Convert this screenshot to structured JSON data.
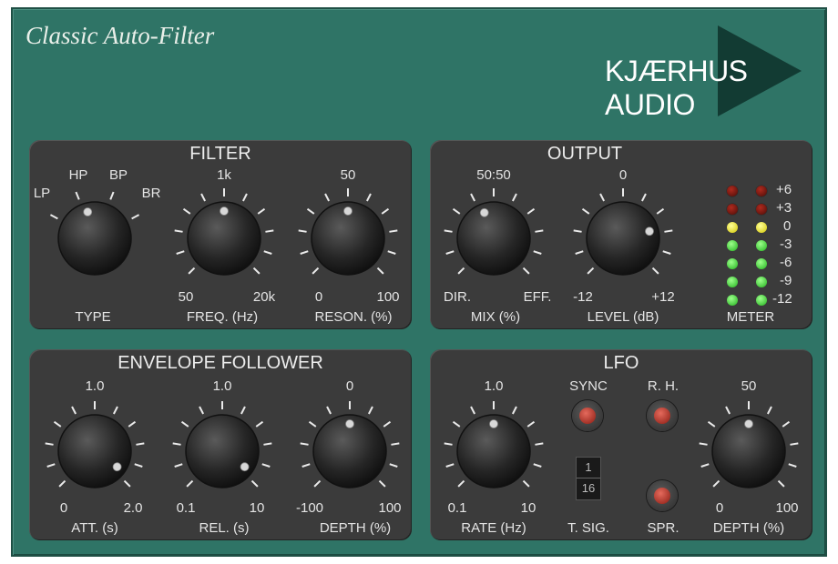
{
  "header": {
    "title": "Classic Auto-Filter",
    "brand": "KJÆRHUS AUDIO"
  },
  "filter": {
    "title": "FILTER",
    "type": {
      "label": "TYPE",
      "options": [
        "LP",
        "HP",
        "BP",
        "BR"
      ]
    },
    "freq": {
      "label": "FREQ. (Hz)",
      "top": "1k",
      "min": "50",
      "max": "20k"
    },
    "reson": {
      "label": "RESON. (%)",
      "top": "50",
      "min": "0",
      "max": "100"
    }
  },
  "output": {
    "title": "OUTPUT",
    "mix": {
      "label": "MIX (%)",
      "top": "50:50",
      "min": "DIR.",
      "max": "EFF."
    },
    "level": {
      "label": "LEVEL (dB)",
      "top": "0",
      "min": "-12",
      "max": "+12"
    },
    "meter": {
      "label": "METER",
      "scale": [
        "+6",
        "+3",
        "0",
        "-3",
        "-6",
        "-9",
        "-12"
      ]
    }
  },
  "envelope": {
    "title": "ENVELOPE FOLLOWER",
    "att": {
      "label": "ATT. (s)",
      "top": "1.0",
      "min": "0",
      "max": "2.0"
    },
    "rel": {
      "label": "REL. (s)",
      "top": "1.0",
      "min": "0.1",
      "max": "10"
    },
    "depth": {
      "label": "DEPTH (%)",
      "top": "0",
      "min": "-100",
      "max": "100"
    }
  },
  "lfo": {
    "title": "LFO",
    "rate": {
      "label": "RATE (Hz)",
      "top": "1.0",
      "min": "0.1",
      "max": "10"
    },
    "sync": {
      "label": "SYNC"
    },
    "rh": {
      "label": "R. H."
    },
    "tsig": {
      "label": "T. SIG.",
      "num": "1",
      "den": "16"
    },
    "spr": {
      "label": "SPR."
    },
    "depth": {
      "label": "DEPTH (%)",
      "top": "50",
      "min": "0",
      "max": "100"
    }
  },
  "colors": {
    "body": "#2f7466",
    "panel": "#3b3b3b",
    "led_on": "#e04a3a"
  }
}
